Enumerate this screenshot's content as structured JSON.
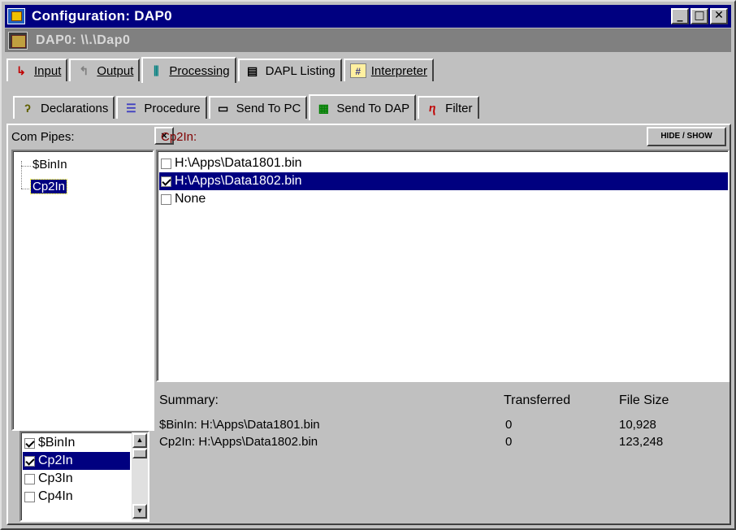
{
  "window": {
    "title": "Configuration: DAP0",
    "controls": {
      "minimize": "_",
      "maximize": "□",
      "close": "✕"
    }
  },
  "subtitle": "DAP0: \\\\.\\Dap0",
  "main_tabs": [
    {
      "label": "Input",
      "icon": "input-icon"
    },
    {
      "label": "Output",
      "icon": "output-icon"
    },
    {
      "label": "Processing",
      "icon": "processing-icon"
    },
    {
      "label": "DAPL Listing",
      "icon": "listing-icon"
    },
    {
      "label": "Interpreter",
      "icon": "interpreter-icon"
    }
  ],
  "sub_tabs": [
    {
      "label": "Declarations",
      "icon": "declarations-icon"
    },
    {
      "label": "Procedure",
      "icon": "procedure-icon"
    },
    {
      "label": "Send To PC",
      "icon": "pc-icon"
    },
    {
      "label": "Send To DAP",
      "icon": "dap-icon"
    },
    {
      "label": "Filter",
      "icon": "filter-icon"
    }
  ],
  "com_pipes": {
    "label": "Com Pipes:",
    "close_label": "×",
    "tree": [
      "$BinIn",
      "Cp2In"
    ],
    "checklist": [
      {
        "label": "$BinIn",
        "checked": true,
        "selected": false
      },
      {
        "label": "Cp2In",
        "checked": true,
        "selected": true
      },
      {
        "label": "Cp3In",
        "checked": false,
        "selected": false
      },
      {
        "label": "Cp4In",
        "checked": false,
        "selected": false
      }
    ]
  },
  "pipe_panel": {
    "label": "Cp2In:",
    "hide_show": "HIDE / SHOW",
    "files": [
      {
        "label": "H:\\Apps\\Data1801.bin",
        "checked": false,
        "selected": false
      },
      {
        "label": "H:\\Apps\\Data1802.bin",
        "checked": true,
        "selected": true
      },
      {
        "label": "None",
        "checked": false,
        "selected": false
      }
    ]
  },
  "summary": {
    "heading": "Summary:",
    "col_transferred": "Transferred",
    "col_filesize": "File Size",
    "rows": [
      {
        "name": "$BinIn: H:\\Apps\\Data1801.bin",
        "transferred": "0",
        "size": "10,928"
      },
      {
        "name": "Cp2In: H:\\Apps\\Data1802.bin",
        "transferred": "0",
        "size": "123,248"
      }
    ]
  }
}
